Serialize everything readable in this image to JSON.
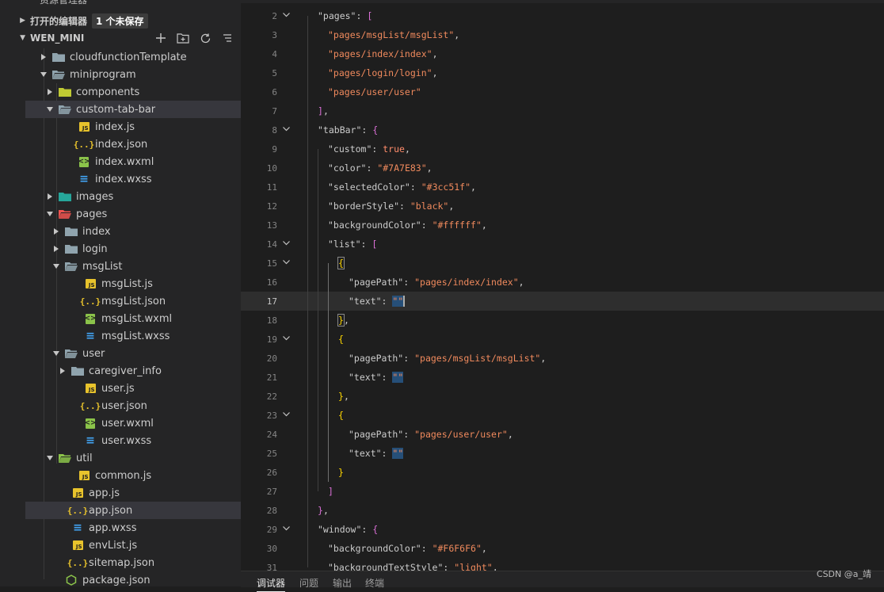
{
  "explorer": {
    "top_cut_label": "资源管理器",
    "open_editors_label": "打开的编辑器",
    "unsaved_badge": "1 个未保存",
    "project_name": "WEN_MINI"
  },
  "tree": [
    {
      "label": "cloudfunctionTemplate"
    },
    {
      "label": "miniprogram"
    },
    {
      "label": "components"
    },
    {
      "label": "custom-tab-bar"
    },
    {
      "label": "index.js"
    },
    {
      "label": "index.json"
    },
    {
      "label": "index.wxml"
    },
    {
      "label": "index.wxss"
    },
    {
      "label": "images"
    },
    {
      "label": "pages"
    },
    {
      "label": "index"
    },
    {
      "label": "login"
    },
    {
      "label": "msgList"
    },
    {
      "label": "msgList.js"
    },
    {
      "label": "msgList.json"
    },
    {
      "label": "msgList.wxml"
    },
    {
      "label": "msgList.wxss"
    },
    {
      "label": "user"
    },
    {
      "label": "caregiver_info"
    },
    {
      "label": "user.js"
    },
    {
      "label": "user.json"
    },
    {
      "label": "user.wxml"
    },
    {
      "label": "user.wxss"
    },
    {
      "label": "util"
    },
    {
      "label": "common.js"
    },
    {
      "label": "app.js"
    },
    {
      "label": "app.json"
    },
    {
      "label": "app.wxss"
    },
    {
      "label": "envList.js"
    },
    {
      "label": "sitemap.json"
    },
    {
      "label": "package.json"
    }
  ],
  "code_lines": [
    {
      "n": "2",
      "parts": [
        "\"pages\"",
        ": ",
        "["
      ]
    },
    {
      "n": "3",
      "parts": [
        "\"pages/msgList/msgList\"",
        ","
      ]
    },
    {
      "n": "4",
      "parts": [
        "\"pages/index/index\"",
        ","
      ]
    },
    {
      "n": "5",
      "parts": [
        "\"pages/login/login\"",
        ","
      ]
    },
    {
      "n": "6",
      "parts": [
        "\"pages/user/user\""
      ]
    },
    {
      "n": "7",
      "parts": [
        "]",
        ","
      ]
    },
    {
      "n": "8",
      "parts": [
        "\"tabBar\"",
        ": ",
        "{"
      ]
    },
    {
      "n": "9",
      "parts": [
        "\"custom\"",
        ": ",
        "true",
        ","
      ]
    },
    {
      "n": "10",
      "parts": [
        "\"color\"",
        ": ",
        "\"#7A7E83\"",
        ","
      ]
    },
    {
      "n": "11",
      "parts": [
        "\"selectedColor\"",
        ": ",
        "\"#3cc51f\"",
        ","
      ]
    },
    {
      "n": "12",
      "parts": [
        "\"borderStyle\"",
        ": ",
        "\"black\"",
        ","
      ]
    },
    {
      "n": "13",
      "parts": [
        "\"backgroundColor\"",
        ": ",
        "\"#ffffff\"",
        ","
      ]
    },
    {
      "n": "14",
      "parts": [
        "\"list\"",
        ": ",
        "["
      ]
    },
    {
      "n": "15",
      "parts": [
        "{"
      ]
    },
    {
      "n": "16",
      "parts": [
        "\"pagePath\"",
        ": ",
        "\"pages/index/index\"",
        ","
      ]
    },
    {
      "n": "17",
      "parts": [
        "\"text\"",
        ": ",
        "\"\""
      ]
    },
    {
      "n": "18",
      "parts": [
        "}",
        ","
      ]
    },
    {
      "n": "19",
      "parts": [
        "{"
      ]
    },
    {
      "n": "20",
      "parts": [
        "\"pagePath\"",
        ": ",
        "\"pages/msgList/msgList\"",
        ","
      ]
    },
    {
      "n": "21",
      "parts": [
        "\"text\"",
        ": ",
        "\"\""
      ]
    },
    {
      "n": "22",
      "parts": [
        "}",
        ","
      ]
    },
    {
      "n": "23",
      "parts": [
        "{"
      ]
    },
    {
      "n": "24",
      "parts": [
        "\"pagePath\"",
        ": ",
        "\"pages/user/user\"",
        ","
      ]
    },
    {
      "n": "25",
      "parts": [
        "\"text\"",
        ": ",
        "\"\""
      ]
    },
    {
      "n": "26",
      "parts": [
        "}"
      ]
    },
    {
      "n": "27",
      "parts": [
        "]"
      ]
    },
    {
      "n": "28",
      "parts": [
        "}",
        ","
      ]
    },
    {
      "n": "29",
      "parts": [
        "\"window\"",
        ": ",
        "{"
      ]
    },
    {
      "n": "30",
      "parts": [
        "\"backgroundColor\"",
        ": ",
        "\"#F6F6F6\"",
        ","
      ]
    },
    {
      "n": "31",
      "parts": [
        "\"backgroundTextStyle\"",
        ": ",
        "\"light\"",
        ","
      ]
    }
  ],
  "panel": {
    "tabs": [
      "调试器",
      "问题",
      "输出",
      "终端"
    ]
  },
  "watermark": "CSDN @a_靖",
  "colors": {
    "sidebar_bg": "#252526",
    "editor_bg": "#1e1e1e",
    "string": "#f08a5d",
    "selected_row": "#37373d"
  }
}
